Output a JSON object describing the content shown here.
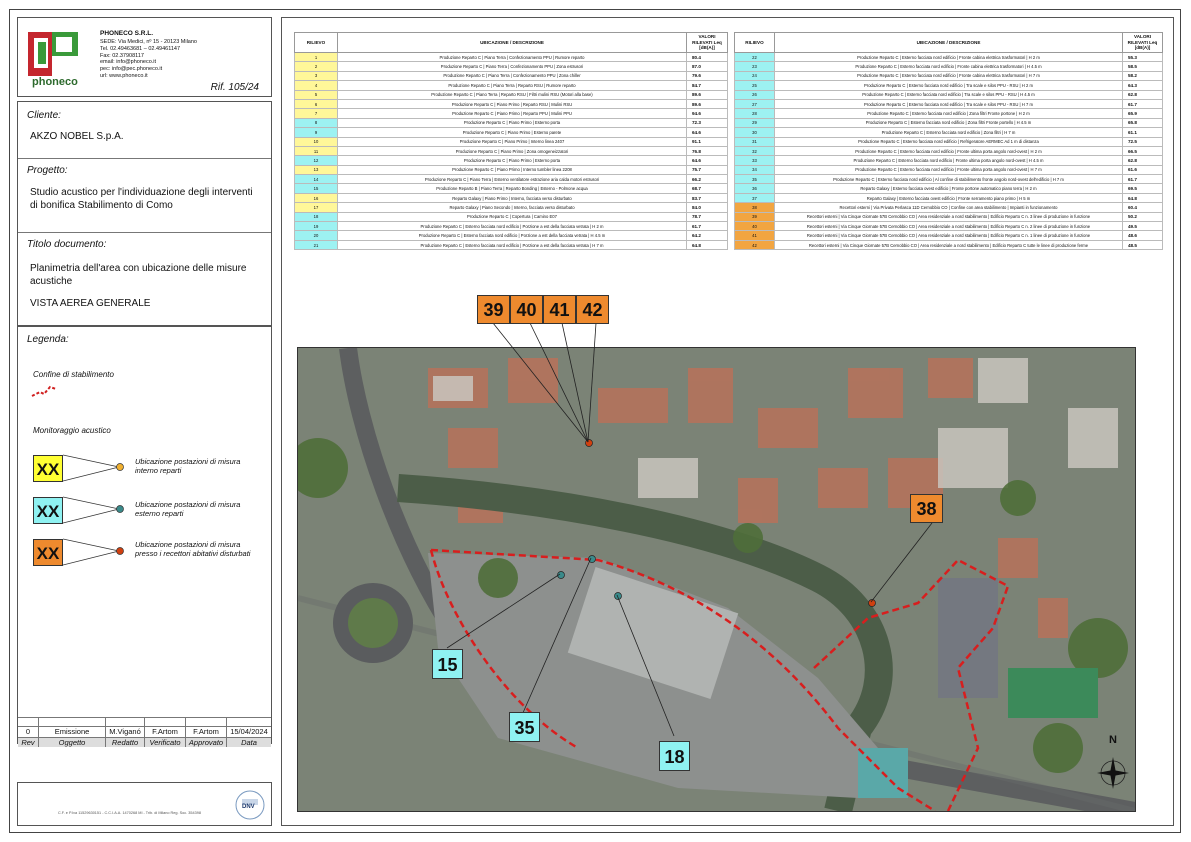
{
  "company": {
    "logo_text": "phoneco",
    "name": "PHONECO S.R.L.",
    "lines": [
      "SEDE: Via Medici, nº 15 - 20123 Milano",
      "Tel. 02.49463681 – 02.49461147",
      "Fax: 02.37908117",
      "email: info@phoneco.it",
      "pec: info@pec.phoneco.it",
      "url: www.phoneco.it"
    ],
    "ref": "Rif. 105/24"
  },
  "info": {
    "client_label": "Cliente:",
    "client": "AKZO NOBEL S.p.A.",
    "project_label": "Progetto:",
    "project": "Studio acustico per l'individuazione degli interventi di bonifica Stabilimento di Como",
    "doc_label": "Titolo documento:",
    "doc_title": "Planimetria dell'area con ubicazione delle misure acustiche",
    "doc_view": "VISTA AEREA GENERALE"
  },
  "legend": {
    "label": "Legenda:",
    "boundary": "Confine di stabilimento",
    "monitoring": "Monitoraggio acustico",
    "items": [
      {
        "tag": "XX",
        "text": "Ubicazione postazioni di misura interno reparti",
        "color": "#ffff33",
        "dot": "#f0b030"
      },
      {
        "tag": "XX",
        "text": "Ubicazione postazioni di misura esterno reparti",
        "color": "#8ff2f2",
        "dot": "#3a8a8a"
      },
      {
        "tag": "XX",
        "text": "Ubicazione postazioni di misura presso i recettori abitativi disturbati",
        "color": "#ee8a2e",
        "dot": "#d04010"
      }
    ]
  },
  "revision": {
    "row": [
      "0",
      "Emissione",
      "M.Viganó",
      "F.Artom",
      "F.Artom",
      "15/04/2024"
    ],
    "headers": [
      "Rev",
      "Oggetto",
      "Redatto",
      "Verificato",
      "Approvato",
      "Data"
    ]
  },
  "footer": {
    "text": "C.F. e P.Iva 11529630151 - C.C.I.A.A. 1470268 MI - Trib. di Milano Reg. Soc. 354398",
    "cert": "DNV"
  },
  "table_headers": {
    "rilievo": "RILIEVO",
    "desc": "UBICAZIONE / DESCRIZIONE",
    "val": "VALORI RILEVATI Leq [dB(A)]"
  },
  "table_left": [
    {
      "n": "1",
      "d": "Produzione Reparto C | Piano Terra | Confezionamento PPU | Rumore reparto",
      "v": "80.4",
      "t": "y"
    },
    {
      "n": "2",
      "d": "Produzione Reparto C | Piano Terra | Confezionamento PPU | Zona estrusori",
      "v": "87.0",
      "t": "y"
    },
    {
      "n": "3",
      "d": "Produzione Reparto C | Piano Terra | Confezionamento PPU | Zona chiller",
      "v": "79.6",
      "t": "y"
    },
    {
      "n": "4",
      "d": "Produzione Reparto C | Piano Terra | Reparto RSU | Rumore reparto",
      "v": "84.7",
      "t": "y"
    },
    {
      "n": "5",
      "d": "Produzione Reparto C | Piano Terra | Reparto RSU | Filtri mulini RSU (Motori alla base)",
      "v": "89.6",
      "t": "y"
    },
    {
      "n": "6",
      "d": "Produzione Reparto C | Piano Primo | Reparto RSU | Mulini RSU",
      "v": "89.6",
      "t": "y"
    },
    {
      "n": "7",
      "d": "Produzione Reparto C | Piano Primo | Reparto PPU | Mulini PPU",
      "v": "94.6",
      "t": "y"
    },
    {
      "n": "8",
      "d": "Produzione Reparto C | Piano Primo | Esterno porta",
      "v": "72.3",
      "t": "c"
    },
    {
      "n": "9",
      "d": "Produzione Reparto C | Piano Primo | Esterno parete",
      "v": "64.6",
      "t": "c"
    },
    {
      "n": "10",
      "d": "Produzione Reparto C | Piano Primo | Interno linea 2407",
      "v": "91.1",
      "t": "y"
    },
    {
      "n": "11",
      "d": "Produzione Reparto C | Piano Primo | Zona omogeneizzatori",
      "v": "76.8",
      "t": "y"
    },
    {
      "n": "12",
      "d": "Produzione Reparto C | Piano Primo | Esterno porta",
      "v": "64.6",
      "t": "c"
    },
    {
      "n": "13",
      "d": "Produzione Reparto C | Piano Primo | Interno tumbler linea 2208",
      "v": "75.7",
      "t": "y"
    },
    {
      "n": "14",
      "d": "Produzione Reparto C | Piano Terra | Esterno ventilatore estrazione aria calda motori estrusori",
      "v": "66.2",
      "t": "c"
    },
    {
      "n": "15",
      "d": "Produzione Reparto B | Piano Terra | Reparto Bonding | Esterno - Polmone acqua",
      "v": "68.7",
      "t": "c"
    },
    {
      "n": "16",
      "d": "Reparto Galaxy | Piano Primo | Interno, facciata verso disturbato",
      "v": "83.7",
      "t": "y"
    },
    {
      "n": "17",
      "d": "Reparto Galaxy | Piano Secondo | Interno, facciata verso disturbato",
      "v": "84.0",
      "t": "y"
    },
    {
      "n": "18",
      "d": "Produzione Reparto C | Copertura | Camino E07",
      "v": "78.7",
      "t": "c"
    },
    {
      "n": "19",
      "d": "Produzione Reparto C | Esterno facciata nord edificio | Porzione a est della facciata vetrata | H 2 m",
      "v": "61.7",
      "t": "c"
    },
    {
      "n": "20",
      "d": "Produzione Reparto C | Esterno facciata nord edificio | Porzione a est della facciata vetrata | H 4.5 m",
      "v": "64.2",
      "t": "c"
    },
    {
      "n": "21",
      "d": "Produzione Reparto C | Esterno facciata nord edificio | Porzione a est della facciata vetrata | H 7 m",
      "v": "64.8",
      "t": "c"
    }
  ],
  "table_right": [
    {
      "n": "22",
      "d": "Produzione Reparto C | Esterno facciata nord edificio | Fronte cabina elettrica trasformatori | H 2 m",
      "v": "55.3",
      "t": "c"
    },
    {
      "n": "23",
      "d": "Produzione Reparto C | Esterno facciata nord edificio | Fronte cabina elettrica trasformatori | H 4.5 m",
      "v": "58.5",
      "t": "c"
    },
    {
      "n": "24",
      "d": "Produzione Reparto C | Esterno facciata nord edificio | Fronte cabina elettrica trasformatori | H 7 m",
      "v": "58.2",
      "t": "c"
    },
    {
      "n": "25",
      "d": "Produzione Reparto C | Esterno facciata nord edificio | Tra scale e silos PPU - RSU | H 2 m",
      "v": "64.3",
      "t": "c"
    },
    {
      "n": "26",
      "d": "Produzione Reparto C | Esterno facciata nord edificio | Tra scale e silos PPU - RSU | H 4.5 m",
      "v": "62.8",
      "t": "c"
    },
    {
      "n": "27",
      "d": "Produzione Reparto C | Esterno facciata nord edificio | Tra scale e silos PPU - RSU | H 7 m",
      "v": "61.7",
      "t": "c"
    },
    {
      "n": "28",
      "d": "Produzione Reparto C | Esterno facciata nord edificio | Zona filtri Fronte portone | H 2 m",
      "v": "65.9",
      "t": "c"
    },
    {
      "n": "29",
      "d": "Produzione Reparto C | Esterno facciata nord edificio | Zona filtri Fronte portello | H 4.5 m",
      "v": "65.8",
      "t": "c"
    },
    {
      "n": "30",
      "d": "Produzione Reparto C | Esterno facciata nord edificio | Zona filtri | H 7 m",
      "v": "61.1",
      "t": "c"
    },
    {
      "n": "31",
      "d": "Produzione Reparto C | Esterno facciata nord edificio | Refrigeratore AERMEC Ad 1 m di distanza",
      "v": "72.5",
      "t": "c"
    },
    {
      "n": "32",
      "d": "Produzione Reparto C | Esterno facciata nord edificio | Fronte ultima porta angolo nord-ovest | H 2 m",
      "v": "66.5",
      "t": "c"
    },
    {
      "n": "33",
      "d": "Produzione Reparto C | Esterno facciata nord edificio | Fronte ultima porta angolo nord-ovest | H 4.5 m",
      "v": "62.8",
      "t": "c"
    },
    {
      "n": "34",
      "d": "Produzione Reparto C | Esterno facciata nord edificio | Fronte ultima porta angolo nord-ovest | H 7 m",
      "v": "61.6",
      "t": "c"
    },
    {
      "n": "35",
      "d": "Produzione Reparto C | Esterno facciata nord edificio | Al confine di stabilimento fronte angolo nord-ovest dell'edificio | H 7 m",
      "v": "61.7",
      "t": "c"
    },
    {
      "n": "36",
      "d": "Reparto Galaxy | Esterno facciata ovest edificio | Fronte portone automatico piano terra | H 2 m",
      "v": "69.5",
      "t": "c"
    },
    {
      "n": "37",
      "d": "Reparto Galaxy | Esterno facciata ovest edificio | Fronte serramento piano primo | H 5 m",
      "v": "64.8",
      "t": "c"
    },
    {
      "n": "38",
      "d": "Recettori esterni | Via Privata Perlasca 11D Cernobbio CO | Confine con area stabilimento | Impianti in funzionamento",
      "v": "60.4",
      "t": "o"
    },
    {
      "n": "39",
      "d": "Recettori esterni | Via Cinque Giornate 57B Cernobbio CO | Area residenziale a nord stabilimento | Edificio Reparto C n. 3 linee di produzione in funzione",
      "v": "50.2",
      "t": "o"
    },
    {
      "n": "40",
      "d": "Recettori esterni | Via Cinque Giornate 57B Cernobbio CO | Area residenziale a nord stabilimento | Edificio Reparto C n. 2 linee di produzione in funzione",
      "v": "49.5",
      "t": "o"
    },
    {
      "n": "41",
      "d": "Recettori esterni | Via Cinque Giornate 57B Cernobbio CO | Area residenziale a nord stabilimento | Edificio Reparto C n. 1 linee di produzione in funzione",
      "v": "48.6",
      "t": "o"
    },
    {
      "n": "42",
      "d": "Recettori esterni | Via Cinque Giornate 57B Cernobbio CO | Area residenziale a nord stabilimento | Edificio Reparto C tutte le linee di produzione ferme",
      "v": "48.5",
      "t": "o"
    }
  ],
  "map_tags": {
    "t39": "39",
    "t40": "40",
    "t41": "41",
    "t42": "42",
    "t38": "38",
    "t15": "15",
    "t35": "35",
    "t18": "18"
  },
  "compass": "N"
}
